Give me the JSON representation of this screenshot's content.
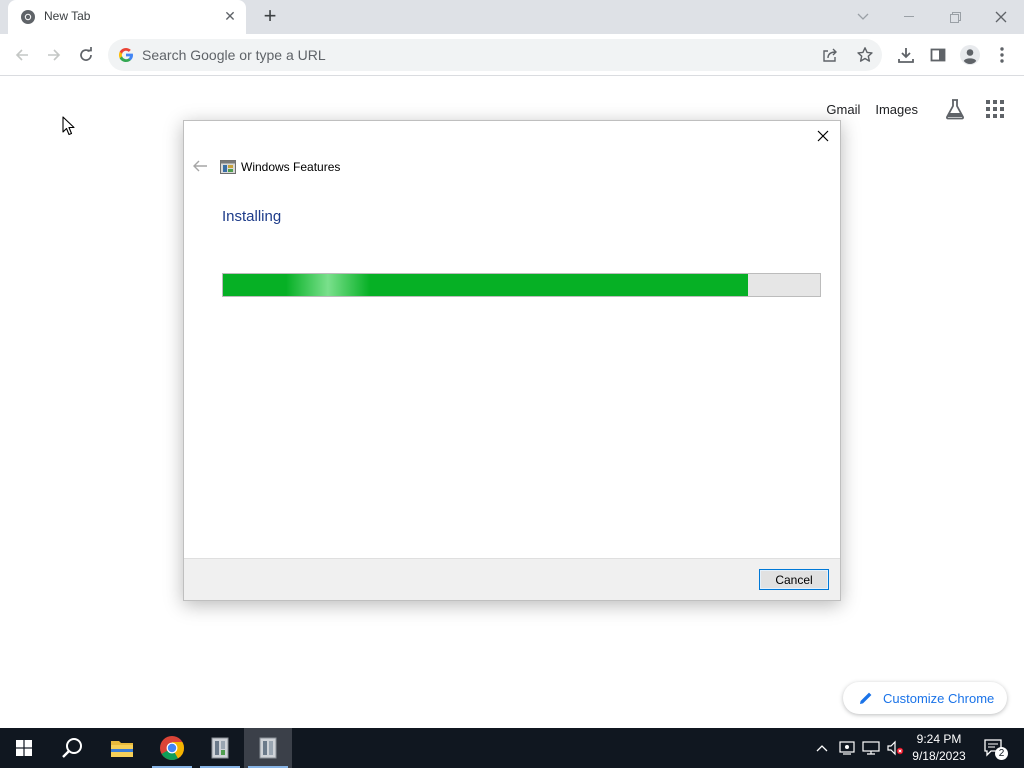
{
  "browser": {
    "tab_title": "New Tab",
    "omnibox_placeholder": "Search Google or type a URL"
  },
  "ntp": {
    "gmail_label": "Gmail",
    "images_label": "Images",
    "customize_label": "Customize Chrome"
  },
  "dialog": {
    "app_title": "Windows Features",
    "heading": "Installing",
    "progress_fraction": 0.88,
    "cancel_label": "Cancel"
  },
  "taskbar": {
    "time": "9:24 PM",
    "date": "9/18/2023",
    "notification_count": "2"
  },
  "colors": {
    "progress_green": "#06b025",
    "heading_blue": "#1e3c8a",
    "link_blue": "#1a73e8",
    "taskbar": "#101720"
  }
}
